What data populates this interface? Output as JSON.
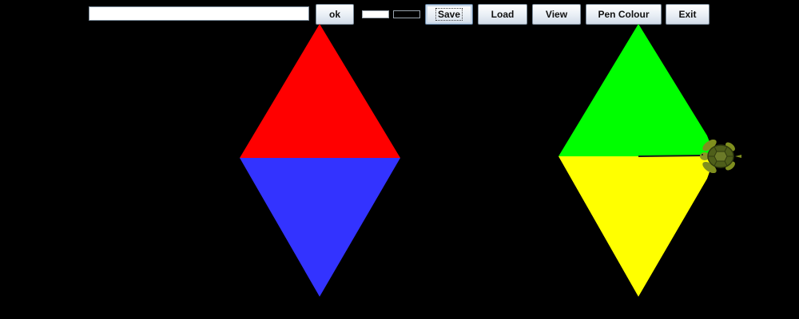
{
  "toolbar": {
    "command_input_value": "",
    "ok_label": "ok",
    "save_label": "Save",
    "load_label": "Load",
    "view_label": "View",
    "pen_colour_label": "Pen Colour",
    "exit_label": "Exit"
  },
  "indicators": {
    "pen_swatch_color": "#ffffff",
    "background_swatch_color": "#000000"
  },
  "canvas": {
    "background": "#000000",
    "shapes": [
      {
        "name": "left-diamond-top-triangle",
        "color": "#ff0000"
      },
      {
        "name": "left-diamond-bottom-triangle",
        "color": "#3333ff"
      },
      {
        "name": "right-diamond-top-triangle",
        "color": "#00ff00"
      },
      {
        "name": "right-diamond-bottom-triangle",
        "color": "#ffff00"
      }
    ],
    "turtle": {
      "icon": "turtle-icon",
      "heading": "east"
    }
  }
}
